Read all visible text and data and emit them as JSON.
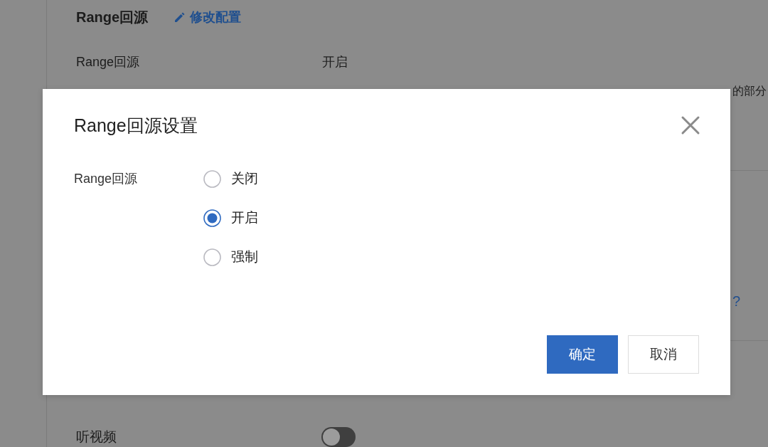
{
  "page": {
    "section": {
      "title": "Range回源",
      "edit_link": "修改配置"
    },
    "rows": [
      {
        "kind": "value",
        "label": "Range回源",
        "value": "开启",
        "note": "的部分"
      },
      {
        "kind": "link",
        "link": "?"
      },
      {
        "kind": "switch",
        "label": "听视频",
        "on": false
      }
    ]
  },
  "dialog": {
    "title": "Range回源设置",
    "field_label": "Range回源",
    "options": [
      {
        "label": "关闭",
        "selected": false
      },
      {
        "label": "开启",
        "selected": true
      },
      {
        "label": "强制",
        "selected": false
      }
    ],
    "buttons": [
      {
        "label": "确定",
        "kind": "primary"
      },
      {
        "label": "取消",
        "kind": "secondary"
      }
    ]
  }
}
